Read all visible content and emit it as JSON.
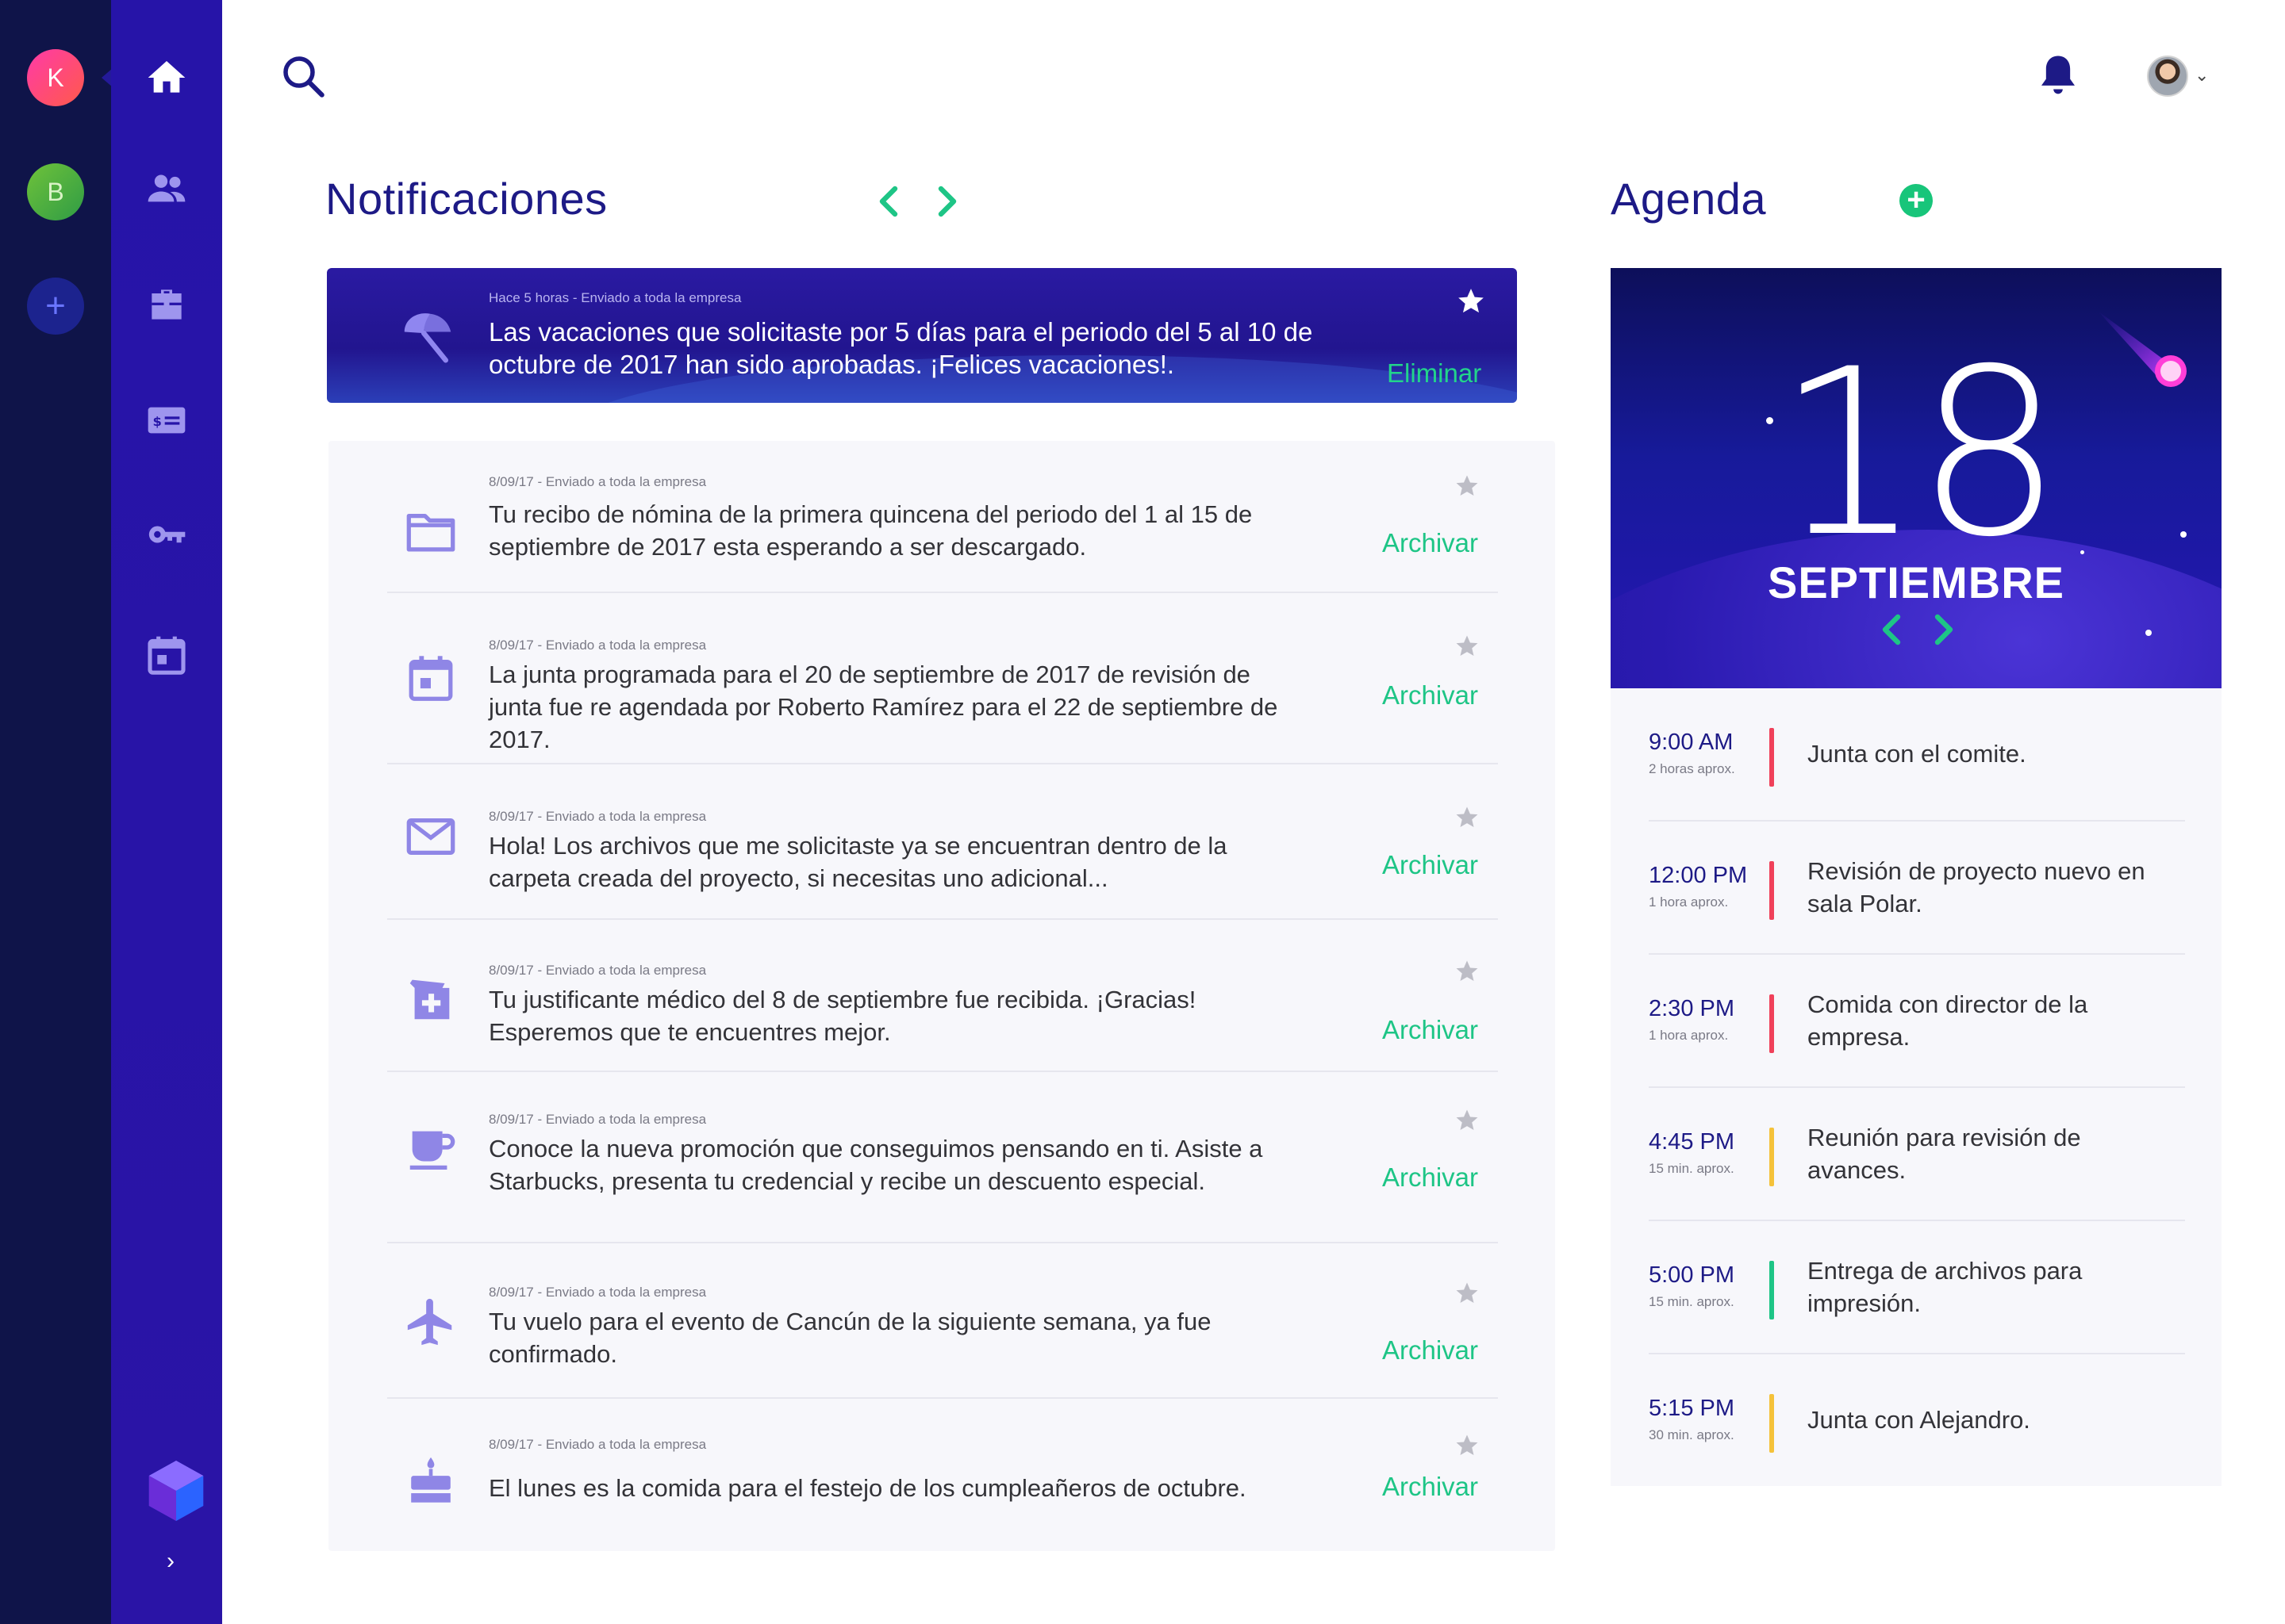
{
  "companies": [
    {
      "initial": "K"
    },
    {
      "initial": "B"
    },
    {
      "initial": "+"
    }
  ],
  "sidebar": {
    "items": [
      {
        "icon": "home-icon"
      },
      {
        "icon": "people-icon"
      },
      {
        "icon": "briefcase-icon"
      },
      {
        "icon": "payroll-icon"
      },
      {
        "icon": "key-icon"
      },
      {
        "icon": "calendar-icon"
      }
    ],
    "expand_label": "›"
  },
  "notifications": {
    "title": "Notificaciones",
    "highlighted": {
      "meta": "Hace 5 horas - Enviado a toda la empresa",
      "message": "Las vacaciones que solicitaste por 5 días para el periodo del 5 al 10 de octubre de 2017 han sido aprobadas. ¡Felices vacaciones!.",
      "action": "Eliminar",
      "icon": "beach-umbrella-icon"
    },
    "items": [
      {
        "icon": "folder-icon",
        "meta": "8/09/17 - Enviado a toda la empresa",
        "message": "Tu recibo de nómina de la primera quincena del periodo del 1 al 15 de septiembre de 2017 esta esperando a ser descargado.",
        "action": "Archivar"
      },
      {
        "icon": "calendar-icon",
        "meta": "8/09/17 - Enviado a toda la empresa",
        "message": "La junta programada para el 20 de septiembre de 2017 de revisión de junta fue re agendada por Roberto Ramírez para el 22 de septiembre de 2017.",
        "action": "Archivar"
      },
      {
        "icon": "mail-icon",
        "meta": "8/09/17 - Enviado a toda la empresa",
        "message": "Hola! Los archivos que me solicitaste ya se encuentran dentro de la carpeta creada del proyecto, si necesitas uno adicional...",
        "action": "Archivar"
      },
      {
        "icon": "medical-icon",
        "meta": "8/09/17 - Enviado a toda la empresa",
        "message": "Tu justificante médico del 8 de septiembre fue recibida. ¡Gracias! Esperemos que te encuentres mejor.",
        "action": "Archivar"
      },
      {
        "icon": "coffee-icon",
        "meta": "8/09/17 - Enviado a toda la empresa",
        "message": "Conoce la nueva promoción que conseguimos pensando en ti. Asiste a Starbucks, presenta tu credencial y recibe un descuento especial.",
        "action": "Archivar"
      },
      {
        "icon": "airplane-icon",
        "meta": "8/09/17 - Enviado a toda la empresa",
        "message": "Tu vuelo para el evento de Cancún de la siguiente semana, ya fue confirmado.",
        "action": "Archivar"
      },
      {
        "icon": "cake-icon",
        "meta": "8/09/17 - Enviado a toda la empresa",
        "message": "El lunes es la comida para el festejo de los cumpleañeros de octubre.",
        "action": "Archivar"
      }
    ]
  },
  "agenda": {
    "title": "Agenda",
    "day": "18",
    "month": "SEPTIEMBRE",
    "events": [
      {
        "time": "9:00 AM",
        "duration": "2 horas aprox.",
        "title": "Junta con el comite.",
        "color": "#f0415a"
      },
      {
        "time": "12:00 PM",
        "duration": "1 hora aprox.",
        "title": "Revisión de proyecto nuevo en sala Polar.",
        "color": "#f0415a"
      },
      {
        "time": "2:30 PM",
        "duration": "1 hora aprox.",
        "title": "Comida con director de la empresa.",
        "color": "#f0415a"
      },
      {
        "time": "4:45 PM",
        "duration": "15 min. aprox.",
        "title": "Reunión para revisión de avances.",
        "color": "#f5c23a"
      },
      {
        "time": "5:00 PM",
        "duration": "15 min. aprox.",
        "title": "Entrega de archivos para impresión.",
        "color": "#1ec586"
      },
      {
        "time": "5:15 PM",
        "duration": "30 min. aprox.",
        "title": "Junta con Alejandro.",
        "color": "#f5c23a"
      }
    ]
  },
  "colors": {
    "rail": "#0f1449",
    "sidebar": "#2614a8",
    "accent_green": "#1ec586",
    "title_blue": "#1d1a86"
  }
}
